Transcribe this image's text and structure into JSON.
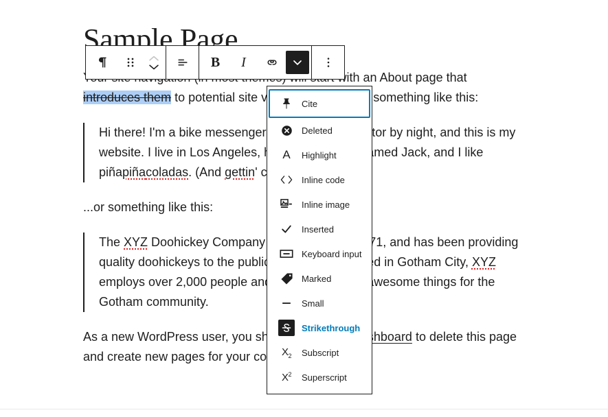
{
  "document": {
    "heading": "Sample Page",
    "paragraphs": [
      {
        "id": "p1",
        "parts": [
          {
            "text": "Your site navigation (in most themes) will start with an About page ",
            "style": "plain"
          },
          {
            "text": "that ",
            "style": "plain"
          },
          {
            "text": "introduces them",
            "style": "selected-strikethrough"
          },
          {
            "text": " to potential site visitors. It might say something like this:",
            "style": "plain"
          }
        ]
      }
    ],
    "line1": "Your site navigation (in most themes) will start with an About page",
    "line2_pre": "that ",
    "line2_selected": "introduces them",
    "line2_post": " to potential site visitors. It might say something like this:",
    "quote1": {
      "line1": "Hi there! I'm a bike messenger by day, aspiring actor by night, and this is my",
      "line2": "website. I live in Los Angeles, have a great dog named Jack, and I like piña",
      "line3_a": "coladas",
      "line3_b": ". (And ",
      "line3_c": "gettin",
      "line3_d": "' caught in the rain.)",
      "spell_pina": "piña"
    },
    "mid_text": "...or something like this:",
    "quote2": {
      "line1_a": "The ",
      "line1_b": "XYZ",
      "line1_c": " Doohickey Company was founded in 1971, and has been providing",
      "line2_a": "quality doohickeys to the public ever since. Located in Gotham City, ",
      "line2_b": "XYZ",
      "line3": "employs over 2,000 people and does all kinds of awesome things for the",
      "line4": "Gotham community."
    },
    "closing": {
      "part1": "As a new WordPress user, you should go to your ",
      "link": "dashboard",
      "part2": " to delete this page",
      "part3": "and create new pages for your content. Have fun!"
    }
  },
  "toolbar": {
    "groups": [
      {
        "id": "block-group",
        "buttons": [
          {
            "id": "block-type",
            "icon": "paragraph-icon",
            "label": "Paragraph",
            "state": "default"
          },
          {
            "id": "drag-handle",
            "icon": "drag-handle-icon",
            "label": "Drag",
            "state": "default"
          },
          {
            "id": "move-up-down",
            "icon": "move-arrows-icon",
            "label": "Move up / Move down",
            "state": "default"
          }
        ]
      },
      {
        "id": "align-group",
        "buttons": [
          {
            "id": "align",
            "icon": "align-left-icon",
            "label": "Align text",
            "state": "default"
          }
        ]
      },
      {
        "id": "format-group",
        "buttons": [
          {
            "id": "bold",
            "icon": "bold-icon",
            "label": "Bold",
            "state": "default"
          },
          {
            "id": "italic",
            "icon": "italic-icon",
            "label": "Italic",
            "state": "default"
          },
          {
            "id": "link",
            "icon": "link-icon",
            "label": "Link",
            "state": "default"
          },
          {
            "id": "more-formats",
            "icon": "chevron-down-icon",
            "label": "More",
            "state": "active"
          }
        ]
      },
      {
        "id": "options-group",
        "buttons": [
          {
            "id": "options",
            "icon": "ellipsis-vertical-icon",
            "label": "Options",
            "state": "default"
          }
        ]
      }
    ]
  },
  "menu": {
    "items": [
      {
        "label": "Cite",
        "icon": "pin-icon",
        "state": "focused"
      },
      {
        "label": "Deleted",
        "icon": "close-circle-icon",
        "state": "default"
      },
      {
        "label": "Highlight",
        "icon": "letter-a-icon",
        "state": "default"
      },
      {
        "label": "Inline code",
        "icon": "angle-brackets-icon",
        "state": "default"
      },
      {
        "label": "Inline image",
        "icon": "inline-image-icon",
        "state": "default"
      },
      {
        "label": "Inserted",
        "icon": "check-icon",
        "state": "default"
      },
      {
        "label": "Keyboard input",
        "icon": "keyboard-icon",
        "state": "default"
      },
      {
        "label": "Marked",
        "icon": "tag-icon",
        "state": "default"
      },
      {
        "label": "Small",
        "icon": "minus-icon",
        "state": "default"
      },
      {
        "label": "Strikethrough",
        "icon": "strikethrough-icon",
        "state": "selected"
      },
      {
        "label": "Subscript",
        "icon": "subscript-icon",
        "state": "default"
      },
      {
        "label": "Superscript",
        "icon": "superscript-icon",
        "state": "default"
      }
    ]
  },
  "colors": {
    "accent": "#007cba",
    "ink": "#1e1e1e",
    "selection": "#accef7",
    "spellcheck": "#e02020"
  }
}
